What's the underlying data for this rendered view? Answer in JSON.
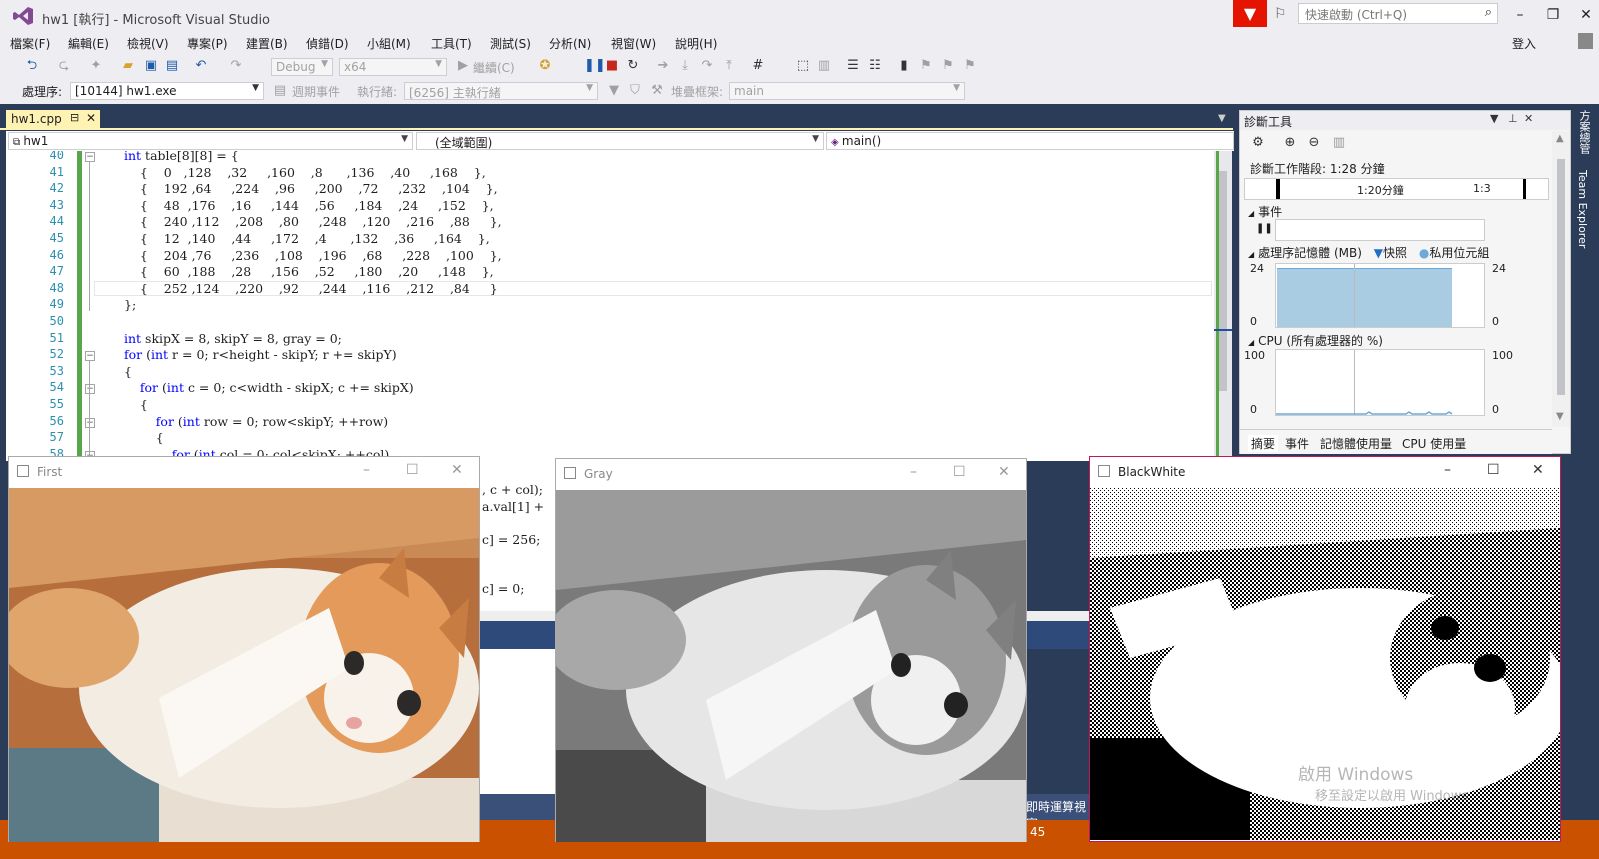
{
  "window": {
    "title": "hw1 [執行] - Microsoft Visual Studio",
    "quick_launch_placeholder": "快速啟動 (Ctrl+Q)",
    "login": "登入"
  },
  "menu": [
    "檔案(F)",
    "編輯(E)",
    "檢視(V)",
    "專案(P)",
    "建置(B)",
    "偵錯(D)",
    "小組(M)",
    "工具(T)",
    "測試(S)",
    "分析(N)",
    "視窗(W)",
    "說明(H)"
  ],
  "toolbar": {
    "config": "Debug",
    "platform": "x64",
    "continue_label": "繼續(C)",
    "process_label": "處理序:",
    "process_value": "[10144] hw1.exe",
    "lifecycle_label": "週期事件",
    "thread_label": "執行緒:",
    "thread_value": "[6256] 主執行緒",
    "stackframe_label": "堆疊框架:",
    "stackframe_value": "main"
  },
  "editor": {
    "tab_name": "hw1.cpp",
    "nav_project": "hw1",
    "nav_scope": "(全域範圍)",
    "nav_function": "main()",
    "line_numbers": [
      "40",
      "41",
      "42",
      "43",
      "44",
      "45",
      "46",
      "47",
      "48",
      "49",
      "50",
      "51",
      "52",
      "53",
      "54",
      "55",
      "56",
      "57",
      "58"
    ],
    "lines": [
      "int table[8][8] = {",
      "    {    0   ,128    ,32     ,160    ,8      ,136    ,40     ,168    },",
      "    {    192 ,64     ,224    ,96     ,200    ,72     ,232    ,104    },",
      "    {    48  ,176    ,16     ,144    ,56     ,184    ,24     ,152    },",
      "    {    240 ,112    ,208    ,80     ,248    ,120    ,216    ,88     },",
      "    {    12  ,140    ,44     ,172    ,4      ,132    ,36     ,164    },",
      "    {    204 ,76     ,236    ,108    ,196    ,68     ,228    ,100    },",
      "    {    60  ,188    ,28     ,156    ,52     ,180    ,20     ,148    },",
      "    {    252 ,124    ,220    ,92     ,244    ,116    ,212    ,84     }",
      "};",
      "",
      "int skipX = 8, skipY = 8, gray = 0;",
      "for (int r = 0; r<height - skipY; r += skipY)",
      "{",
      "    for (int c = 0; c<width - skipX; c += skipX)",
      "    {",
      "        for (int row = 0; row<skipY; ++row)",
      "        {",
      "            for (int col = 0; col<skipX; ++col)"
    ],
    "hidden_fragments": [
      ", c + col);",
      "a.val[1] +",
      "c] = 256;",
      "c] = 0;"
    ]
  },
  "diagnostics": {
    "title": "診斷工具",
    "session": "診斷工作階段: 1:28 分鐘",
    "timeline_tick1": "1:20分鐘",
    "timeline_tick2": "1:3",
    "events_label": "事件",
    "memory_label": "處理序記憶體 (MB)",
    "memory_snapshot_legend": "快照",
    "memory_private_legend": "私用位元組",
    "memory_max": "24",
    "memory_min": "0",
    "cpu_label": "CPU (所有處理器的 %)",
    "cpu_max": "100",
    "cpu_min": "0",
    "tabs": [
      "摘要",
      "事件",
      "記憶體使用量",
      "CPU 使用量"
    ],
    "memory_fill_fraction": 0.92
  },
  "sidebar": [
    "方案總管",
    "Team Explorer"
  ],
  "windows": {
    "first": "First",
    "gray": "Gray",
    "blackwhite": "BlackWhite"
  },
  "status": {
    "number": "45",
    "realtime": "即時運算視窗"
  },
  "watermark": {
    "line1": "啟用 Windows",
    "line2": "移至設定以啟用 Windows"
  }
}
